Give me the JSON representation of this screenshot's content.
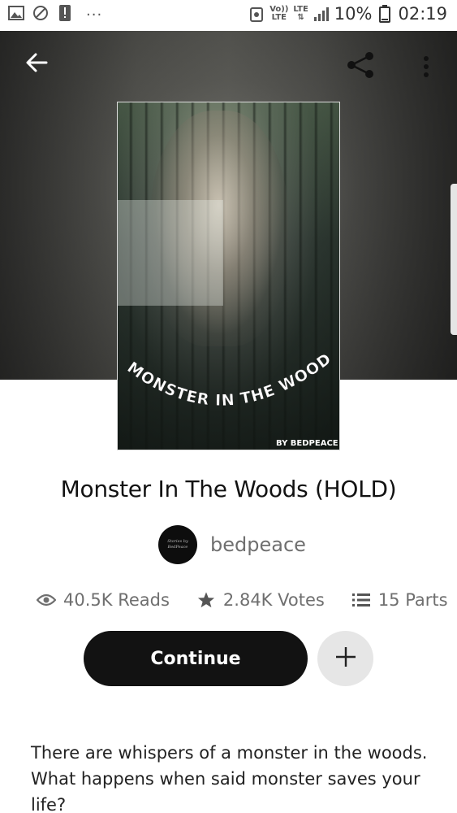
{
  "status_bar": {
    "icons": [
      "gallery-icon",
      "blocked-icon",
      "alert-icon"
    ],
    "more": "...",
    "volte_line1": "Vo))",
    "volte_line2": "LTE",
    "lte": "LTE",
    "battery_percent": "10%",
    "time": "02:19"
  },
  "header": {
    "back_icon": "back-arrow-icon",
    "share_icon": "share-icon",
    "more_icon": "more-vertical-icon"
  },
  "cover": {
    "title_art": "MONSTER IN THE WOODS",
    "byline": "BY BEDPEACE"
  },
  "story": {
    "title": "Monster In The Woods (HOLD)",
    "author": "bedpeace",
    "avatar_text": "Stories by BedPeace"
  },
  "stats": {
    "reads": "40.5K Reads",
    "votes": "2.84K Votes",
    "parts": "15 Parts"
  },
  "actions": {
    "continue_label": "Continue",
    "add_icon": "plus-icon"
  },
  "description": {
    "line1": "There are whispers of a monster in the woods.",
    "line2": "What happens when said monster saves your life?"
  },
  "colors": {
    "primary_button": "#121212",
    "secondary_button": "#e6e6e6",
    "muted_text": "#6f6f6f"
  }
}
